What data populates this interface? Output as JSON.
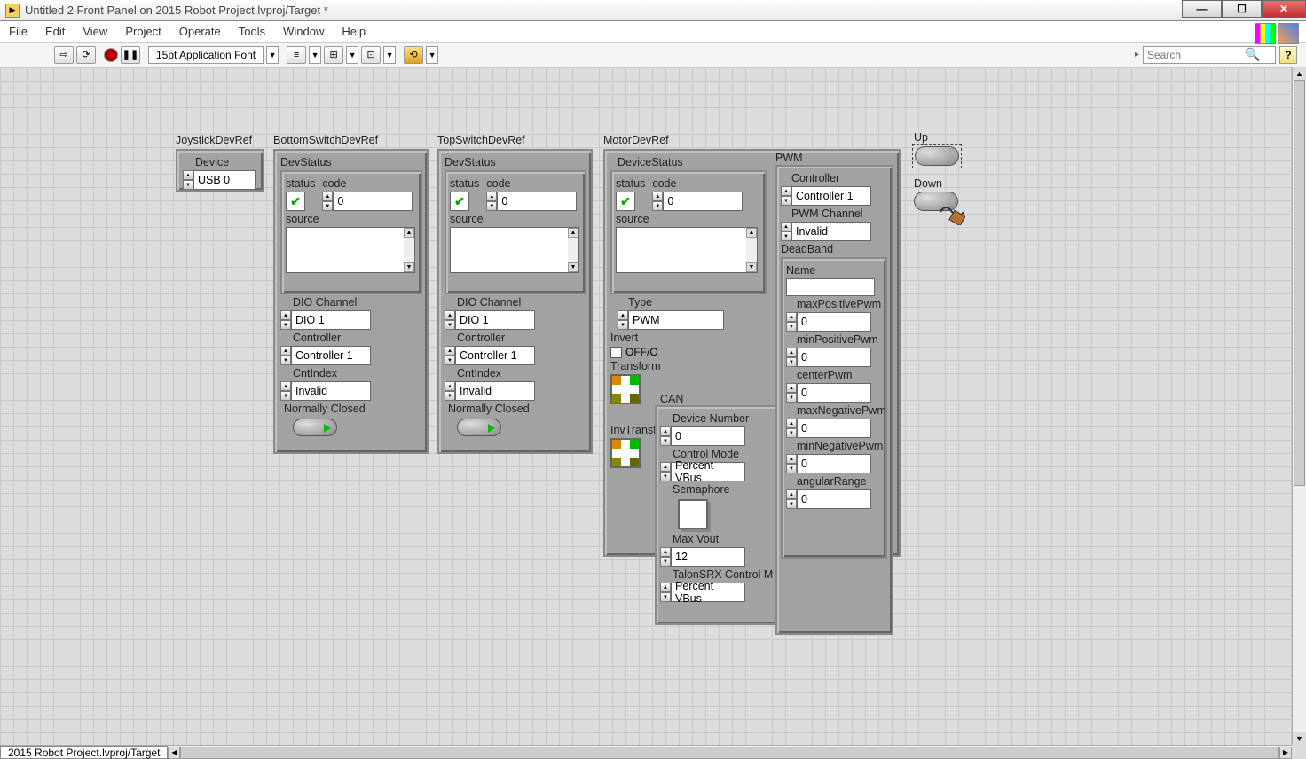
{
  "titlebar": {
    "text": "Untitled 2 Front Panel on 2015 Robot Project.lvproj/Target *"
  },
  "menu": {
    "file": "File",
    "edit": "Edit",
    "view": "View",
    "project": "Project",
    "operate": "Operate",
    "tools": "Tools",
    "window": "Window",
    "help": "Help"
  },
  "toolbar": {
    "font": "15pt Application Font",
    "search_placeholder": "Search",
    "help": "?"
  },
  "tab": {
    "name": "2015 Robot Project.lvproj/Target"
  },
  "joystick": {
    "label": "JoystickDevRef",
    "device_label": "Device",
    "device_value": "USB 0"
  },
  "bottomsw": {
    "label": "BottomSwitchDevRef",
    "devstatus": "DevStatus",
    "status": "status",
    "code": "code",
    "code_val": "0",
    "source": "source",
    "dio_ch": "DIO Channel",
    "dio_val": "DIO 1",
    "controller": "Controller",
    "controller_val": "Controller 1",
    "cnt": "CntIndex",
    "cnt_val": "Invalid",
    "nc": "Normally Closed"
  },
  "topsw": {
    "label": "TopSwitchDevRef",
    "devstatus": "DevStatus",
    "status": "status",
    "code": "code",
    "code_val": "0",
    "source": "source",
    "dio_ch": "DIO Channel",
    "dio_val": "DIO 1",
    "controller": "Controller",
    "controller_val": "Controller 1",
    "cnt": "CntIndex",
    "cnt_val": "Invalid",
    "nc": "Normally Closed"
  },
  "motor": {
    "label": "MotorDevRef",
    "devstatus": "DeviceStatus",
    "status": "status",
    "code": "code",
    "code_val": "0",
    "source": "source",
    "type": "Type",
    "type_val": "PWM",
    "invert": "Invert",
    "invert_val": "OFF/O",
    "transform": "Transform",
    "invtransf": "InvTransf",
    "can": "CAN",
    "devnum": "Device Number",
    "devnum_val": "0",
    "ctlmode": "Control Mode",
    "ctlmode_val": "Percent VBus",
    "sema": "Semaphore",
    "maxvout": "Max Vout",
    "maxvout_val": "12",
    "talon": "TalonSRX Control M",
    "talon_val": "Percent VBus",
    "pwm": "PWM",
    "pwm_controller": "Controller",
    "pwm_controller_val": "Controller 1",
    "pwm_channel": "PWM Channel",
    "pwm_channel_val": "Invalid",
    "deadband": "DeadBand",
    "name": "Name",
    "name_val": "",
    "maxpos": "maxPositivePwm",
    "maxpos_val": "0",
    "minpos": "minPositivePwm",
    "minpos_val": "0",
    "center": "centerPwm",
    "center_val": "0",
    "maxneg": "maxNegativePwm",
    "maxneg_val": "0",
    "minneg": "minNegativePwm",
    "minneg_val": "0",
    "angular": "angularRange",
    "angular_val": "0"
  },
  "updown": {
    "up": "Up",
    "down": "Down"
  }
}
